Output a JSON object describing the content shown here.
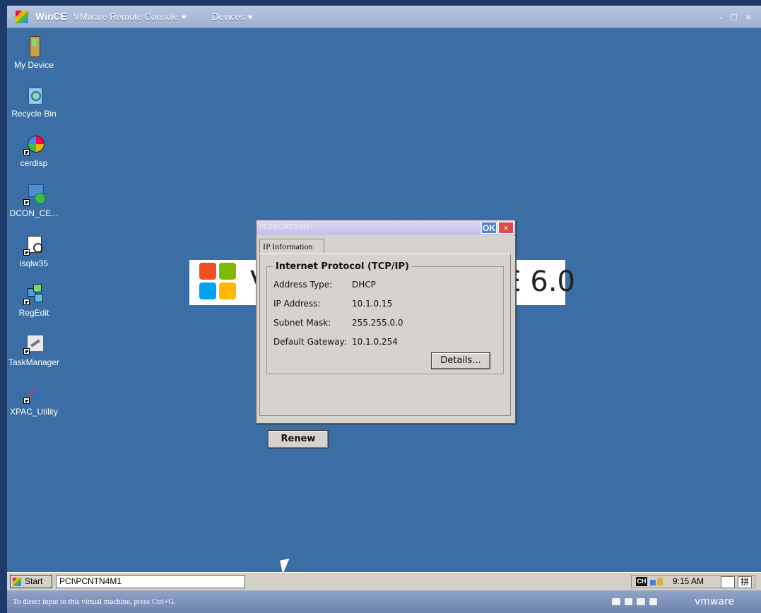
{
  "vm_window": {
    "app_name": "WinCE",
    "console_label": "VMware Remote Console",
    "devices_label": "Devices",
    "window_controls": "- □ ×"
  },
  "desktop": {
    "icons": [
      {
        "label": "My Device",
        "icon": "device-icon"
      },
      {
        "label": "Recycle Bin",
        "icon": "recycle-bin-icon"
      },
      {
        "label": "cerdisp",
        "icon": "cerdisp-icon"
      },
      {
        "label": "DCON_CE...",
        "icon": "dcon-icon"
      },
      {
        "label": "isqlw35",
        "icon": "isqlw35-icon"
      },
      {
        "label": "RegEdit",
        "icon": "regedit-icon"
      },
      {
        "label": "TaskManager",
        "icon": "taskmanager-icon"
      },
      {
        "label": "XPAC_Utility",
        "icon": "xpac-utility-icon"
      }
    ]
  },
  "splash": {
    "left": "V",
    "right": "E 6.0"
  },
  "dialog": {
    "title": "PCI\\PCNTN4M1",
    "ok": "OK",
    "close": "×",
    "tab": "IP Information",
    "group_title": "Internet Protocol (TCP/IP)",
    "rows": [
      {
        "label": "Address Type:",
        "value": "DHCP"
      },
      {
        "label": "IP Address:",
        "value": "10.1.0.15"
      },
      {
        "label": "Subnet Mask:",
        "value": "255.255.0.0"
      },
      {
        "label": "Default Gateway:",
        "value": "10.1.0.254"
      }
    ],
    "details_button": "Details...",
    "renew_button": "Renew"
  },
  "taskbar": {
    "start": "Start",
    "task_text": "PCI\\PCNTN4M1",
    "ime_ch": "CH",
    "time": "9:15 AM",
    "ime_right": "拼"
  },
  "statusbar": {
    "message": "To direct input to this virtual machine, press Ctrl+G.",
    "brand": "vmware"
  }
}
